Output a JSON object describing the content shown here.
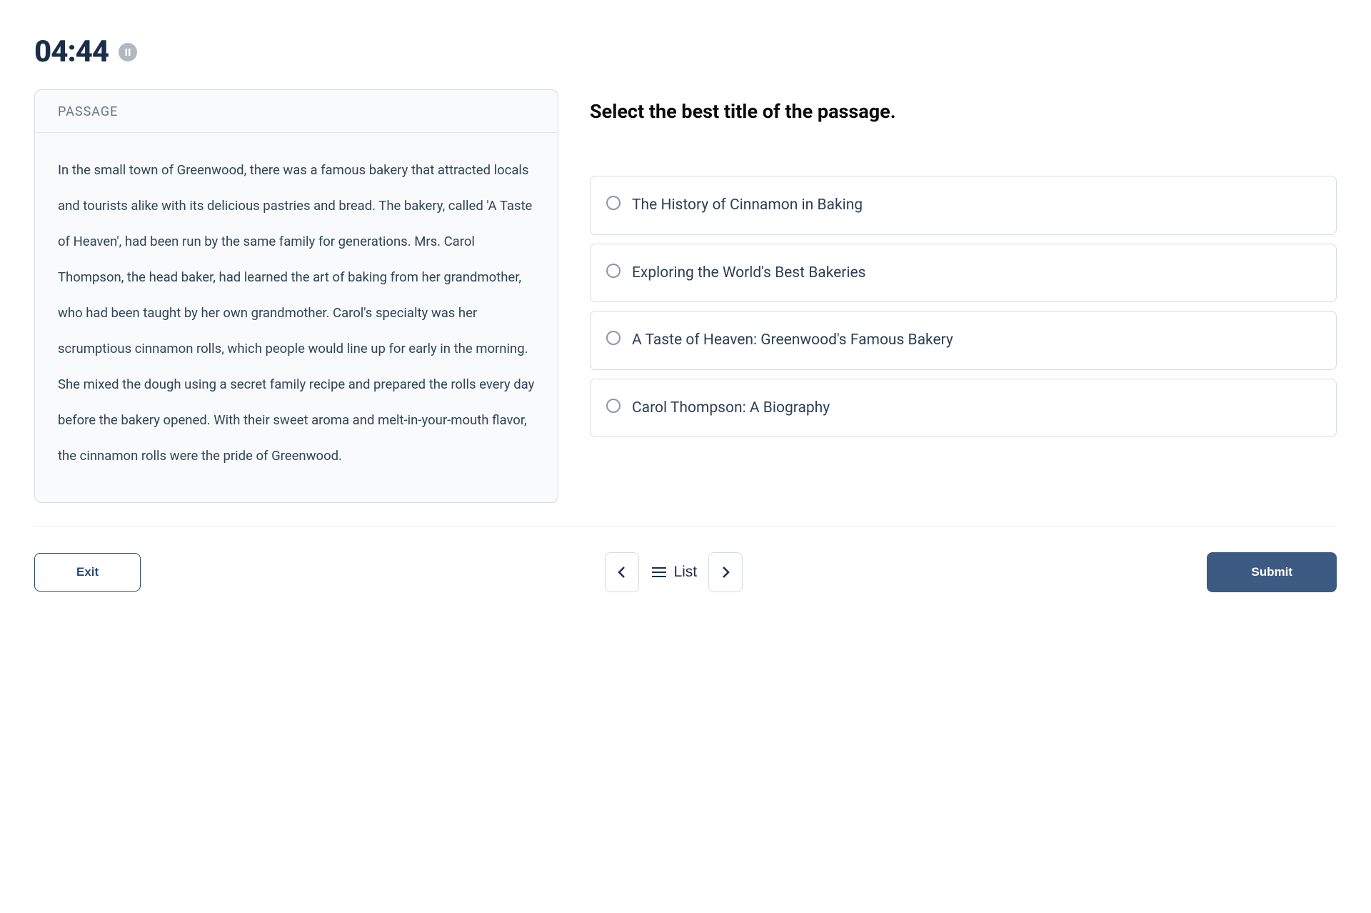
{
  "timer": "04:44",
  "passage": {
    "label": "PASSAGE",
    "text": "In the small town of Greenwood, there was a famous bakery that attracted locals and tourists alike with its delicious pastries and bread. The bakery, called 'A Taste of Heaven', had been run by the same family for generations. Mrs. Carol Thompson, the head baker, had learned the art of baking from her grandmother, who had been taught by her own grandmother. Carol's specialty was her scrumptious cinnamon rolls, which people would line up for early in the morning. She mixed the dough using a secret family recipe and prepared the rolls every day before the bakery opened. With their sweet aroma and melt-in-your-mouth flavor, the cinnamon rolls were the pride of Greenwood."
  },
  "question": "Select the best title of the passage.",
  "options": [
    "The History of Cinnamon in Baking",
    "Exploring the World's Best Bakeries",
    "A Taste of Heaven: Greenwood's Famous Bakery",
    "Carol Thompson: A Biography"
  ],
  "footer": {
    "exit": "Exit",
    "list": "List",
    "submit": "Submit"
  }
}
